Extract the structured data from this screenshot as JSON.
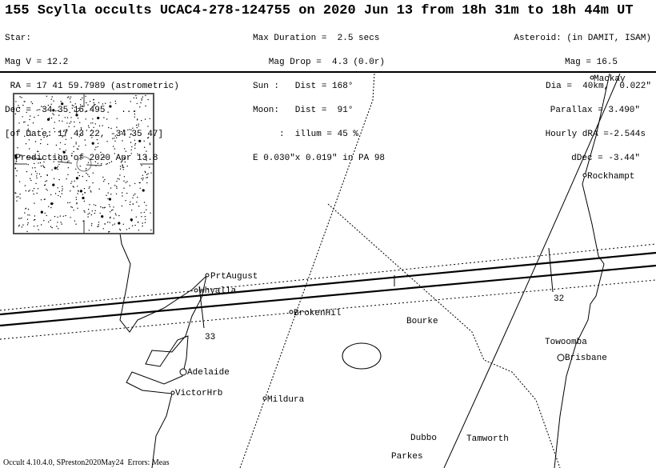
{
  "title": "155 Scylla occults UCAC4-278-124755 on 2020 Jun 13 from 18h 31m to 18h 44m UT",
  "star_block": [
    "Star:",
    "Mag V = 12.2",
    " RA = 17 41 59.7989 (astrometric)",
    "Dec = -34 35 16.495   ...",
    "[of Date: 17 43 22, -34 35 47]",
    "  Prediction of 2020 Apr 13.8"
  ],
  "event_block": [
    "Max Duration =  2.5 secs",
    "   Mag Drop =  4.3 (0.0r)",
    "Sun :   Dist = 168°",
    "Moon:   Dist =  91°",
    "     :  illum = 45 %",
    "E 0.030\"x 0.019\" in PA 98"
  ],
  "asteroid_block": [
    "Asteroid: (in DAMIT, ISAM)",
    "Mag = 16.5",
    "Dia =  40km,  0.022\"",
    "Parallax = 3.490\"",
    "Hourly dRA =-2.544s",
    "dDec = -3.44\""
  ],
  "cities": [
    {
      "name": "Mackay"
    },
    {
      "name": "Rockhampt"
    },
    {
      "name": "PrtAugust"
    },
    {
      "name": "Whyalla"
    },
    {
      "name": "BrokenHil"
    },
    {
      "name": "Bourke"
    },
    {
      "name": "Towoomba"
    },
    {
      "name": "Brisbane"
    },
    {
      "name": "Adelaide"
    },
    {
      "name": "VictorHrb"
    },
    {
      "name": "Mildura"
    },
    {
      "name": "Dubbo"
    },
    {
      "name": "Tamworth"
    },
    {
      "name": "Parkes"
    }
  ],
  "latitude_marks": [
    "33",
    "32"
  ],
  "footer": "Occult 4.10.4.0, SPreston2020May24  Errors: Meas"
}
